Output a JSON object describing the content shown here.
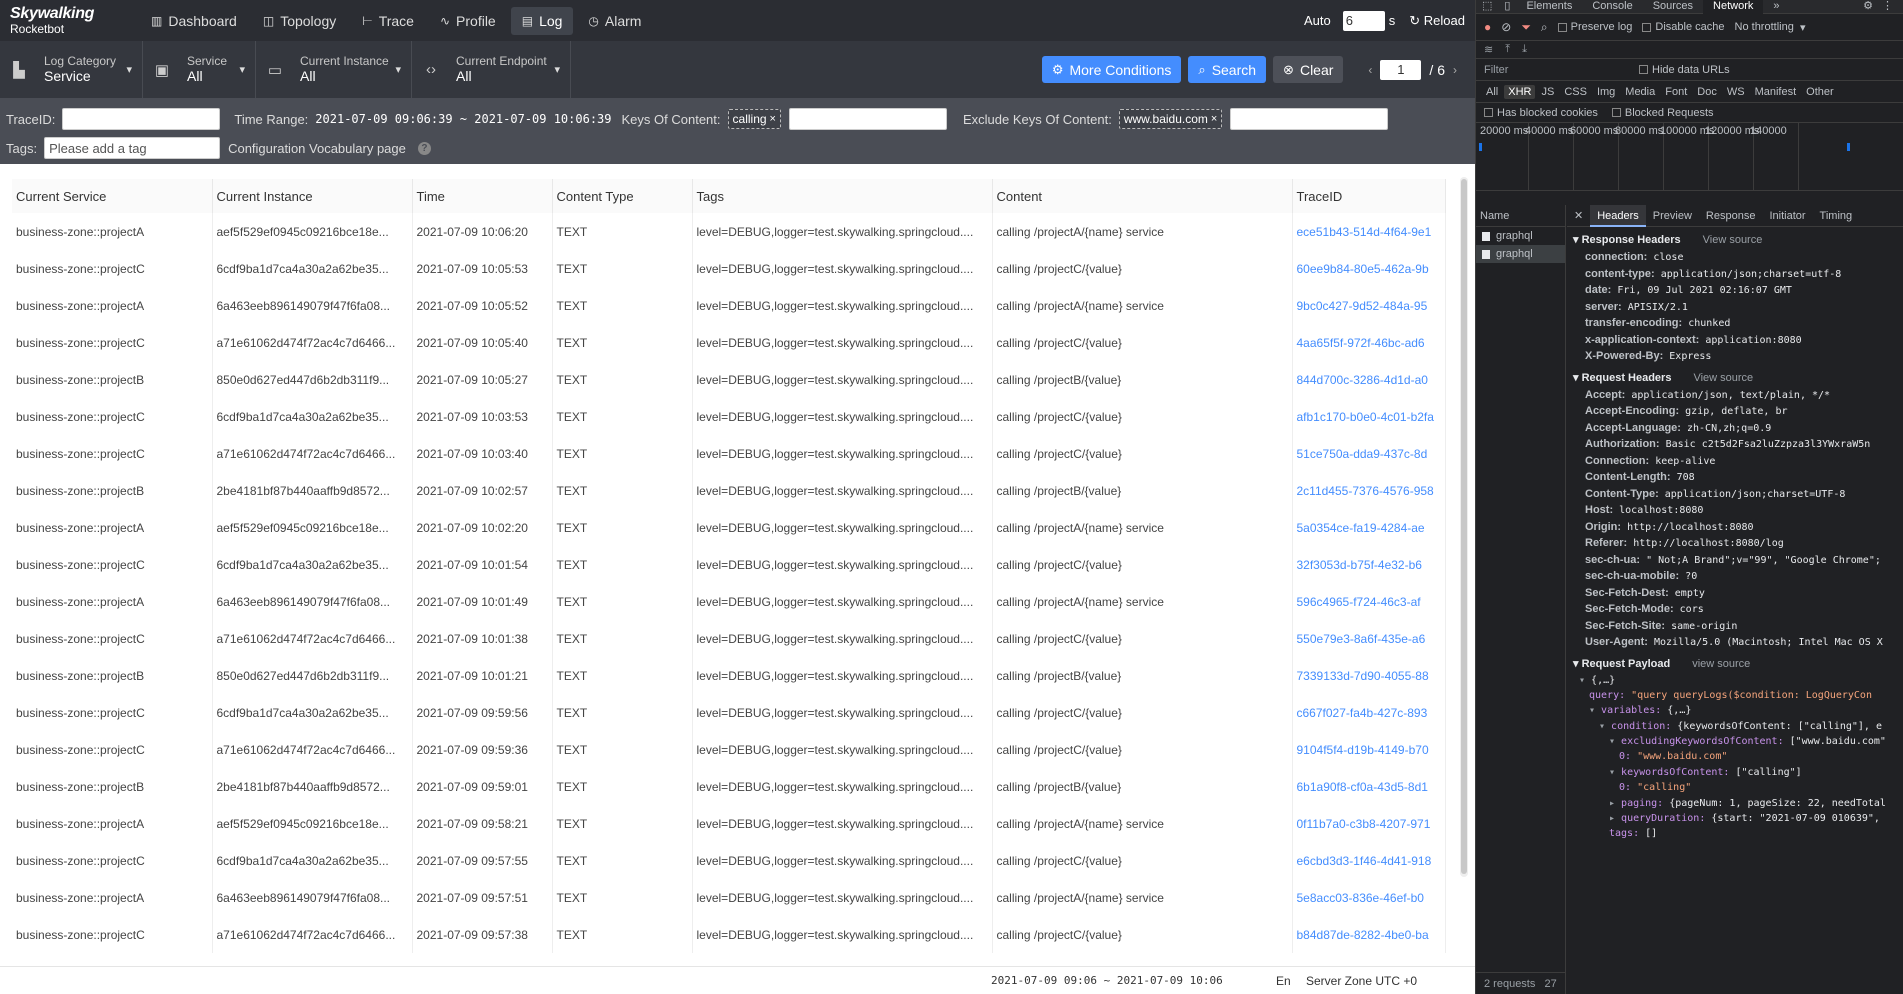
{
  "app": {
    "logo_title": "Skywalking",
    "logo_sub": "Rocketbot",
    "nav": [
      {
        "label": "Dashboard",
        "icon": "dashboard-icon",
        "glyph": "▥"
      },
      {
        "label": "Topology",
        "icon": "topology-icon",
        "glyph": "◫"
      },
      {
        "label": "Trace",
        "icon": "trace-icon",
        "glyph": "⊢"
      },
      {
        "label": "Profile",
        "icon": "profile-icon",
        "glyph": "∿"
      },
      {
        "label": "Log",
        "icon": "log-icon",
        "glyph": "▤"
      },
      {
        "label": "Alarm",
        "icon": "alarm-icon",
        "glyph": "◷"
      }
    ],
    "auto_label": "Auto",
    "auto_value": "6",
    "auto_unit": "s",
    "reload_label": "Reload"
  },
  "filters": {
    "log_category": {
      "label": "Log Category",
      "value": "Service"
    },
    "service": {
      "label": "Service",
      "value": "All"
    },
    "instance": {
      "label": "Current Instance",
      "value": "All"
    },
    "endpoint": {
      "label": "Current Endpoint",
      "value": "All"
    },
    "more_conditions": "More Conditions",
    "search": "Search",
    "clear": "Clear",
    "page_current": "1",
    "page_total": "/ 6"
  },
  "conditions": {
    "trace_id_label": "TraceID:",
    "trace_id_value": "",
    "time_range_label": "Time Range:",
    "time_range_value": "2021-07-09 09:06:39 ~ 2021-07-09 10:06:39",
    "keys_label": "Keys Of Content:",
    "keys_tag": "calling",
    "exclude_label": "Exclude Keys Of Content:",
    "exclude_tag": "www.baidu.com",
    "tags_label": "Tags:",
    "tags_placeholder": "Please add a tag",
    "vocab_label": "Configuration Vocabulary page"
  },
  "table": {
    "columns": [
      "Current Service",
      "Current Instance",
      "Time",
      "Content Type",
      "Tags",
      "Content",
      "TraceID"
    ],
    "rows": [
      [
        "business-zone::projectA",
        "aef5f529ef0945c09216bce18e...",
        "2021-07-09 10:06:20",
        "TEXT",
        "level=DEBUG,logger=test.skywalking.springcloud....",
        "calling /projectA/{name} service",
        "ece51b43-514d-4f64-9e1"
      ],
      [
        "business-zone::projectC",
        "6cdf9ba1d7ca4a30a2a62be35...",
        "2021-07-09 10:05:53",
        "TEXT",
        "level=DEBUG,logger=test.skywalking.springcloud....",
        "calling /projectC/{value}",
        "60ee9b84-80e5-462a-9b"
      ],
      [
        "business-zone::projectA",
        "6a463eeb896149079f47f6fa08...",
        "2021-07-09 10:05:52",
        "TEXT",
        "level=DEBUG,logger=test.skywalking.springcloud....",
        "calling /projectA/{name} service",
        "9bc0c427-9d52-484a-95"
      ],
      [
        "business-zone::projectC",
        "a71e61062d474f72ac4c7d6466...",
        "2021-07-09 10:05:40",
        "TEXT",
        "level=DEBUG,logger=test.skywalking.springcloud....",
        "calling /projectC/{value}",
        "4aa65f5f-972f-46bc-ad6"
      ],
      [
        "business-zone::projectB",
        "850e0d627ed447d6b2db311f9...",
        "2021-07-09 10:05:27",
        "TEXT",
        "level=DEBUG,logger=test.skywalking.springcloud....",
        "calling /projectB/{value}",
        "844d700c-3286-4d1d-a0"
      ],
      [
        "business-zone::projectC",
        "6cdf9ba1d7ca4a30a2a62be35...",
        "2021-07-09 10:03:53",
        "TEXT",
        "level=DEBUG,logger=test.skywalking.springcloud....",
        "calling /projectC/{value}",
        "afb1c170-b0e0-4c01-b2fa"
      ],
      [
        "business-zone::projectC",
        "a71e61062d474f72ac4c7d6466...",
        "2021-07-09 10:03:40",
        "TEXT",
        "level=DEBUG,logger=test.skywalking.springcloud....",
        "calling /projectC/{value}",
        "51ce750a-dda9-437c-8d"
      ],
      [
        "business-zone::projectB",
        "2be4181bf87b440aaffb9d8572...",
        "2021-07-09 10:02:57",
        "TEXT",
        "level=DEBUG,logger=test.skywalking.springcloud....",
        "calling /projectB/{value}",
        "2c11d455-7376-4576-958"
      ],
      [
        "business-zone::projectA",
        "aef5f529ef0945c09216bce18e...",
        "2021-07-09 10:02:20",
        "TEXT",
        "level=DEBUG,logger=test.skywalking.springcloud....",
        "calling /projectA/{name} service",
        "5a0354ce-fa19-4284-ae"
      ],
      [
        "business-zone::projectC",
        "6cdf9ba1d7ca4a30a2a62be35...",
        "2021-07-09 10:01:54",
        "TEXT",
        "level=DEBUG,logger=test.skywalking.springcloud....",
        "calling /projectC/{value}",
        "32f3053d-b75f-4e32-b6"
      ],
      [
        "business-zone::projectA",
        "6a463eeb896149079f47f6fa08...",
        "2021-07-09 10:01:49",
        "TEXT",
        "level=DEBUG,logger=test.skywalking.springcloud....",
        "calling /projectA/{name} service",
        "596c4965-f724-46c3-af"
      ],
      [
        "business-zone::projectC",
        "a71e61062d474f72ac4c7d6466...",
        "2021-07-09 10:01:38",
        "TEXT",
        "level=DEBUG,logger=test.skywalking.springcloud....",
        "calling /projectC/{value}",
        "550e79e3-8a6f-435e-a6"
      ],
      [
        "business-zone::projectB",
        "850e0d627ed447d6b2db311f9...",
        "2021-07-09 10:01:21",
        "TEXT",
        "level=DEBUG,logger=test.skywalking.springcloud....",
        "calling /projectB/{value}",
        "7339133d-7d90-4055-88"
      ],
      [
        "business-zone::projectC",
        "6cdf9ba1d7ca4a30a2a62be35...",
        "2021-07-09 09:59:56",
        "TEXT",
        "level=DEBUG,logger=test.skywalking.springcloud....",
        "calling /projectC/{value}",
        "c667f027-fa4b-427c-893"
      ],
      [
        "business-zone::projectC",
        "a71e61062d474f72ac4c7d6466...",
        "2021-07-09 09:59:36",
        "TEXT",
        "level=DEBUG,logger=test.skywalking.springcloud....",
        "calling /projectC/{value}",
        "9104f5f4-d19b-4149-b70"
      ],
      [
        "business-zone::projectB",
        "2be4181bf87b440aaffb9d8572...",
        "2021-07-09 09:59:01",
        "TEXT",
        "level=DEBUG,logger=test.skywalking.springcloud....",
        "calling /projectB/{value}",
        "6b1a90f8-cf0a-43d5-8d1"
      ],
      [
        "business-zone::projectA",
        "aef5f529ef0945c09216bce18e...",
        "2021-07-09 09:58:21",
        "TEXT",
        "level=DEBUG,logger=test.skywalking.springcloud....",
        "calling /projectA/{name} service",
        "0f11b7a0-c3b8-4207-971"
      ],
      [
        "business-zone::projectC",
        "6cdf9ba1d7ca4a30a2a62be35...",
        "2021-07-09 09:57:55",
        "TEXT",
        "level=DEBUG,logger=test.skywalking.springcloud....",
        "calling /projectC/{value}",
        "e6cbd3d3-1f46-4d41-918"
      ],
      [
        "business-zone::projectA",
        "6a463eeb896149079f47f6fa08...",
        "2021-07-09 09:57:51",
        "TEXT",
        "level=DEBUG,logger=test.skywalking.springcloud....",
        "calling /projectA/{name} service",
        "5e8acc03-836e-46ef-b0"
      ],
      [
        "business-zone::projectC",
        "a71e61062d474f72ac4c7d6466...",
        "2021-07-09 09:57:38",
        "TEXT",
        "level=DEBUG,logger=test.skywalking.springcloud....",
        "calling /projectC/{value}",
        "b84d87de-8282-4be0-ba"
      ]
    ]
  },
  "footer": {
    "range": "2021-07-09 09:06 ~ 2021-07-09 10:06",
    "lang": "En",
    "zone": "Server Zone UTC +0"
  },
  "devtools": {
    "tabs": [
      "Elements",
      "Console",
      "Sources",
      "Network",
      "»"
    ],
    "preserve_log": "Preserve log",
    "disable_cache": "Disable cache",
    "throttling": "No throttling",
    "filter_placeholder": "Filter",
    "hide_data_urls": "Hide data URLs",
    "types": [
      "All",
      "XHR",
      "JS",
      "CSS",
      "Img",
      "Media",
      "Font",
      "Doc",
      "WS",
      "Manifest",
      "Other"
    ],
    "has_blocked_cookies": "Has blocked cookies",
    "blocked_requests": "Blocked Requests",
    "timeline_labels": [
      "20000 ms",
      "40000 ms",
      "60000 ms",
      "80000 ms",
      "100000 ms",
      "120000 ms",
      "140000"
    ],
    "name_header": "Name",
    "requests": [
      "graphql",
      "graphql"
    ],
    "status": "2 requests",
    "status_tail": "27",
    "detail_tabs": [
      "Headers",
      "Preview",
      "Response",
      "Initiator",
      "Timing"
    ],
    "response_headers_title": "Response Headers",
    "view_source": "View source",
    "response_headers": [
      [
        "connection:",
        "close"
      ],
      [
        "content-type:",
        "application/json;charset=utf-8"
      ],
      [
        "date:",
        "Fri, 09 Jul 2021 02:16:07 GMT"
      ],
      [
        "server:",
        "APISIX/2.1"
      ],
      [
        "transfer-encoding:",
        "chunked"
      ],
      [
        "x-application-context:",
        "application:8080"
      ],
      [
        "X-Powered-By:",
        "Express"
      ]
    ],
    "request_headers_title": "Request Headers",
    "request_headers": [
      [
        "Accept:",
        "application/json, text/plain, */*"
      ],
      [
        "Accept-Encoding:",
        "gzip, deflate, br"
      ],
      [
        "Accept-Language:",
        "zh-CN,zh;q=0.9"
      ],
      [
        "Authorization:",
        "Basic c2t5d2Fsa2luZzpza3l3YWxraW5n"
      ],
      [
        "Connection:",
        "keep-alive"
      ],
      [
        "Content-Length:",
        "708"
      ],
      [
        "Content-Type:",
        "application/json;charset=UTF-8"
      ],
      [
        "Host:",
        "localhost:8080"
      ],
      [
        "Origin:",
        "http://localhost:8080"
      ],
      [
        "Referer:",
        "http://localhost:8080/log"
      ],
      [
        "sec-ch-ua:",
        "\" Not;A Brand\";v=\"99\", \"Google Chrome\";"
      ],
      [
        "sec-ch-ua-mobile:",
        "?0"
      ],
      [
        "Sec-Fetch-Dest:",
        "empty"
      ],
      [
        "Sec-Fetch-Mode:",
        "cors"
      ],
      [
        "Sec-Fetch-Site:",
        "same-origin"
      ],
      [
        "User-Agent:",
        "Mozilla/5.0 (Macintosh; Intel Mac OS X"
      ]
    ],
    "payload_title": "Request Payload",
    "view_source2": "view source",
    "payload_lines": [
      {
        "indent": 0,
        "tri": "▾ ",
        "key": "",
        "val": "{,…}"
      },
      {
        "indent": 1,
        "tri": "",
        "key": "query: ",
        "val": "\"query queryLogs($condition: LogQueryCon"
      },
      {
        "indent": 1,
        "tri": "▾ ",
        "key": "variables: ",
        "val": "{,…}"
      },
      {
        "indent": 2,
        "tri": "▾ ",
        "key": "condition: ",
        "val": "{keywordsOfContent: [\"calling\"], e"
      },
      {
        "indent": 3,
        "tri": "▾ ",
        "key": "excludingKeywordsOfContent: ",
        "val": "[\"www.baidu.com\""
      },
      {
        "indent": 4,
        "tri": "",
        "key": "0: ",
        "val": "\"www.baidu.com\""
      },
      {
        "indent": 3,
        "tri": "▾ ",
        "key": "keywordsOfContent: ",
        "val": "[\"calling\"]"
      },
      {
        "indent": 4,
        "tri": "",
        "key": "0: ",
        "val": "\"calling\""
      },
      {
        "indent": 3,
        "tri": "▸ ",
        "key": "paging: ",
        "val": "{pageNum: 1, pageSize: 22, needTotal"
      },
      {
        "indent": 3,
        "tri": "▸ ",
        "key": "queryDuration: ",
        "val": "{start: \"2021-07-09 010639\", "
      },
      {
        "indent": 3,
        "tri": "",
        "key": "tags: ",
        "val": "[]"
      }
    ]
  }
}
